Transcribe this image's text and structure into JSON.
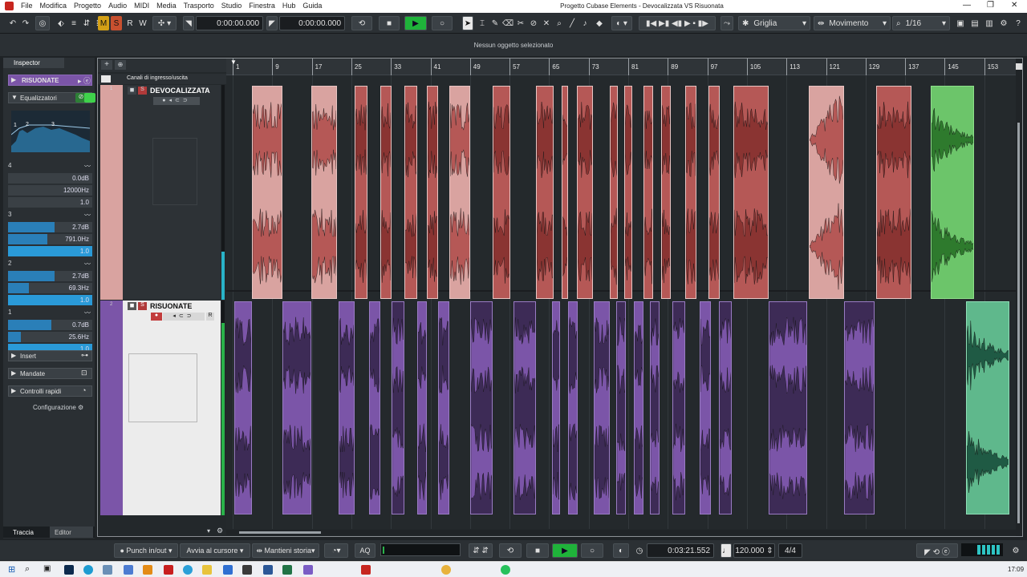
{
  "window": {
    "title": "Progetto Cubase Elements - Devocalizzata VS Risuonata",
    "menu": [
      "File",
      "Modifica",
      "Progetto",
      "Audio",
      "MIDI",
      "Media",
      "Trasporto",
      "Studio",
      "Finestra",
      "Hub",
      "Guida"
    ]
  },
  "toolbar": {
    "mode_buttons": [
      "M",
      "S",
      "R",
      "W"
    ],
    "time_left": "0:00:00.000",
    "time_right": "0:00:00.000",
    "snap_type": "Griglia",
    "drag_mode": "Movimento",
    "quantize": "1/16"
  },
  "info_line": "Nessun oggetto selezionato",
  "inspector": {
    "tab": "Inspector",
    "track_name": "RISUONATE",
    "eq_section": "Equalizzatori",
    "eq_graph_labels": [
      "1",
      "2",
      "3"
    ],
    "bands": [
      {
        "num": "4",
        "rows": [
          {
            "value": "0.0dB",
            "fill": 0.0
          },
          {
            "value": "12000Hz",
            "fill": 0.0
          },
          {
            "value": "1.0",
            "fill": 0.0
          }
        ]
      },
      {
        "num": "3",
        "rows": [
          {
            "value": "2.7dB",
            "fill": 0.55
          },
          {
            "value": "791.0Hz",
            "fill": 0.47
          },
          {
            "value": "1.0",
            "fill": 1.0
          }
        ]
      },
      {
        "num": "2",
        "rows": [
          {
            "value": "2.7dB",
            "fill": 0.55
          },
          {
            "value": "69.3Hz",
            "fill": 0.25
          },
          {
            "value": "1.0",
            "fill": 1.0
          }
        ]
      },
      {
        "num": "1",
        "rows": [
          {
            "value": "0.7dB",
            "fill": 0.51
          },
          {
            "value": "25.6Hz",
            "fill": 0.15
          },
          {
            "value": "1.0",
            "fill": 1.0
          }
        ]
      }
    ],
    "sections": [
      "Insert",
      "Mandate",
      "Controlli rapidi"
    ],
    "config_label": "Configurazione",
    "bottom_tabs": [
      "Traccia",
      "Editor"
    ]
  },
  "tracklist": {
    "folder": "Canali di ingresso/uscita",
    "tracks": [
      {
        "name": "DEVOCALIZZATA",
        "number": "1",
        "color": "#d9a3a0"
      },
      {
        "name": "RISUONATE",
        "number": "2",
        "color": "#7b55a8"
      }
    ]
  },
  "ruler": {
    "bars": [
      "1",
      "9",
      "17",
      "25",
      "33",
      "41",
      "49",
      "57",
      "65",
      "73",
      "81",
      "89",
      "97",
      "105",
      "113",
      "121",
      "129",
      "137",
      "145",
      "153"
    ]
  },
  "transport": {
    "punch": "Punch in/out",
    "cursor_mode": "Avvia al cursore",
    "history": "Mantieni storia",
    "aq": "AQ",
    "time": "0:03:21.552",
    "tempo": "120.000",
    "signature": "4/4"
  },
  "taskbar": {
    "clock": "17:09"
  },
  "colors": {
    "accent_green": "#1fb33a",
    "track1_light": "#d9a3a0",
    "track1_dark": "#b55856",
    "track2_light": "#7b55a8",
    "track2_dark": "#3d2b56",
    "green_event": "#6cc56a",
    "teal_event": "#5fb88c"
  }
}
